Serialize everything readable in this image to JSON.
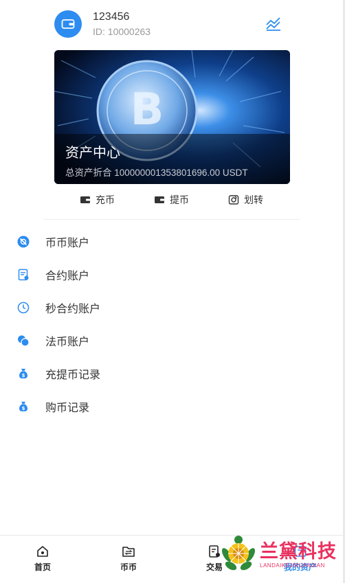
{
  "user": {
    "name": "123456",
    "id_text": "ID: 10000263"
  },
  "banner": {
    "title": "资产中心",
    "total": "总资产折合 100000001353801696.00 USDT"
  },
  "actions": [
    {
      "label": "充币",
      "icon": "wallet-icon"
    },
    {
      "label": "提币",
      "icon": "wallet-icon"
    },
    {
      "label": "划转",
      "icon": "transfer-icon"
    }
  ],
  "menu": [
    {
      "label": "币币账户",
      "icon": "coin-account-icon"
    },
    {
      "label": "合约账户",
      "icon": "contract-document-icon"
    },
    {
      "label": "秒合约账户",
      "icon": "clock-icon"
    },
    {
      "label": "法币账户",
      "icon": "fiat-circles-icon"
    },
    {
      "label": "充提币记录",
      "icon": "money-bag-icon"
    },
    {
      "label": "购币记录",
      "icon": "money-bag-icon"
    }
  ],
  "tabs": [
    {
      "label": "首页",
      "icon": "home-icon"
    },
    {
      "label": "币币",
      "icon": "exchange-icon"
    },
    {
      "label": "交易",
      "icon": "trade-icon"
    },
    {
      "label": "我的资产",
      "icon": "assets-icon"
    }
  ],
  "watermark": {
    "text": "兰黛科技",
    "sub": "LANDAIKEJIRUANJIAN"
  },
  "colors": {
    "accent": "#2d8cf0",
    "watermark": "#e9315f"
  }
}
